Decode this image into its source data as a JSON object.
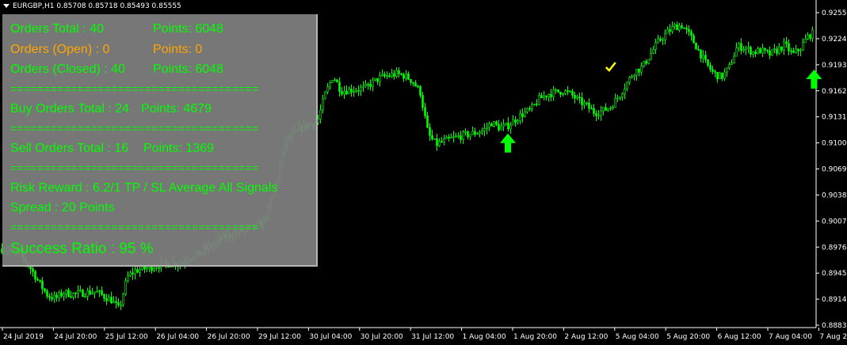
{
  "window": {
    "symbol_header": "EURGBP,H1  0.85708 0.85718 0.85493 0.85555"
  },
  "colors": {
    "background": "#000000",
    "candle": "#00ff00",
    "axis": "#ffffff",
    "panel": "#808080",
    "green_text": "#00ff00",
    "orange_text": "#ffa500",
    "check": "#ffff00"
  },
  "panel": {
    "orders_total": "Orders Total : 40",
    "points_total": "Points: 6048",
    "orders_open": "Orders (Open) : 0",
    "points_open": "Points: 0",
    "orders_closed": "Orders (Closed) : 40",
    "points_closed": "Points: 6048",
    "separator": "=====================================",
    "buy_total": "Buy Orders Total : 24",
    "buy_points": "Points: 4679",
    "sell_total": "Sell Orders Total : 16",
    "sell_points": "Points: 1369",
    "risk_reward": "Risk Reward : 6.2/1  TP / SL  Average All Signals",
    "spread": "Spread : 20 Points",
    "success": "Success Ratio : 95 %"
  },
  "chart_data": {
    "type": "candlestick",
    "symbol": "EURGBP",
    "timeframe": "H1",
    "y_ticks": [
      "0.92550",
      "0.92240",
      "0.91930",
      "0.91620",
      "0.91310",
      "0.91000",
      "0.90690",
      "0.90380",
      "0.90070",
      "0.89760",
      "0.89450",
      "0.89140",
      "0.88830"
    ],
    "ylim": [
      0.8883,
      0.9255
    ],
    "x_ticks": [
      "24 Jul 2019",
      "24 Jul 20:00",
      "25 Jul 12:00",
      "26 Jul 04:00",
      "26 Jul 20:00",
      "29 Jul 12:00",
      "30 Jul 04:00",
      "30 Jul 20:00",
      "31 Jul 12:00",
      "1 Aug 04:00",
      "1 Aug 20:00",
      "2 Aug 12:00",
      "5 Aug 04:00",
      "5 Aug 20:00",
      "6 Aug 12:00",
      "7 Aug 04:00",
      "7 Aug 20:00"
    ],
    "close_path": [
      [
        0,
        0.8974
      ],
      [
        1,
        0.8973
      ],
      [
        2,
        0.897
      ],
      [
        3,
        0.8962
      ],
      [
        4,
        0.8948
      ],
      [
        5,
        0.8932
      ],
      [
        6,
        0.8918
      ],
      [
        7,
        0.8915
      ],
      [
        8,
        0.8922
      ],
      [
        9,
        0.892
      ],
      [
        10,
        0.8921
      ],
      [
        11,
        0.8922
      ],
      [
        12,
        0.8923
      ],
      [
        13,
        0.8918
      ],
      [
        14,
        0.8913
      ],
      [
        15,
        0.8902
      ],
      [
        16,
        0.894
      ],
      [
        17,
        0.8948
      ],
      [
        18,
        0.895
      ],
      [
        19,
        0.8952
      ],
      [
        20,
        0.8955
      ],
      [
        21,
        0.8956
      ],
      [
        22,
        0.8957
      ],
      [
        23,
        0.8958
      ],
      [
        24,
        0.8965
      ],
      [
        25,
        0.8968
      ],
      [
        26,
        0.8974
      ],
      [
        27,
        0.898
      ],
      [
        28,
        0.8987
      ],
      [
        29,
        0.899
      ],
      [
        30,
        0.8994
      ],
      [
        31,
        0.8997
      ],
      [
        32,
        0.9
      ],
      [
        33,
        0.9003
      ],
      [
        34,
        0.9024
      ],
      [
        35,
        0.906
      ],
      [
        36,
        0.9102
      ],
      [
        37,
        0.911
      ],
      [
        38,
        0.9118
      ],
      [
        39,
        0.9122
      ],
      [
        40,
        0.9125
      ],
      [
        41,
        0.9158
      ],
      [
        42,
        0.918
      ],
      [
        43,
        0.9162
      ],
      [
        44,
        0.9163
      ],
      [
        45,
        0.9164
      ],
      [
        46,
        0.9165
      ],
      [
        47,
        0.9172
      ],
      [
        48,
        0.9178
      ],
      [
        49,
        0.918
      ],
      [
        50,
        0.9182
      ],
      [
        51,
        0.918
      ],
      [
        52,
        0.9174
      ],
      [
        53,
        0.916
      ],
      [
        54,
        0.911
      ],
      [
        55,
        0.9098
      ],
      [
        56,
        0.9102
      ],
      [
        57,
        0.9105
      ],
      [
        58,
        0.9108
      ],
      [
        59,
        0.911
      ],
      [
        60,
        0.9112
      ],
      [
        61,
        0.9115
      ],
      [
        62,
        0.9124
      ],
      [
        63,
        0.9118
      ],
      [
        64,
        0.912
      ],
      [
        65,
        0.9128
      ],
      [
        66,
        0.9135
      ],
      [
        67,
        0.914
      ],
      [
        68,
        0.9152
      ],
      [
        69,
        0.9158
      ],
      [
        70,
        0.916
      ],
      [
        71,
        0.9162
      ],
      [
        72,
        0.9158
      ],
      [
        73,
        0.915
      ],
      [
        74,
        0.9144
      ],
      [
        75,
        0.9136
      ],
      [
        76,
        0.9138
      ],
      [
        77,
        0.9143
      ],
      [
        78,
        0.9155
      ],
      [
        79,
        0.917
      ],
      [
        80,
        0.9185
      ],
      [
        81,
        0.919
      ],
      [
        82,
        0.9205
      ],
      [
        83,
        0.922
      ],
      [
        84,
        0.923
      ],
      [
        85,
        0.9238
      ],
      [
        86,
        0.924
      ],
      [
        87,
        0.9228
      ],
      [
        88,
        0.9212
      ],
      [
        89,
        0.9195
      ],
      [
        90,
        0.9183
      ],
      [
        91,
        0.9178
      ],
      [
        92,
        0.919
      ],
      [
        93,
        0.9215
      ],
      [
        94,
        0.9213
      ],
      [
        95,
        0.9208
      ],
      [
        96,
        0.921
      ],
      [
        97,
        0.9205
      ],
      [
        98,
        0.921
      ],
      [
        99,
        0.9217
      ],
      [
        100,
        0.9205
      ],
      [
        101,
        0.9213
      ],
      [
        102,
        0.9228
      ],
      [
        103,
        0.9232
      ]
    ],
    "signals": [
      {
        "type": "buy-arrow",
        "x_label": "1 Aug 20:00",
        "price": 0.9098
      },
      {
        "type": "close-check",
        "x_label": "5 Aug 04:00",
        "price": 0.919
      },
      {
        "type": "buy-arrow",
        "x_label": "7 Aug 20:00",
        "price": 0.9174
      }
    ]
  }
}
